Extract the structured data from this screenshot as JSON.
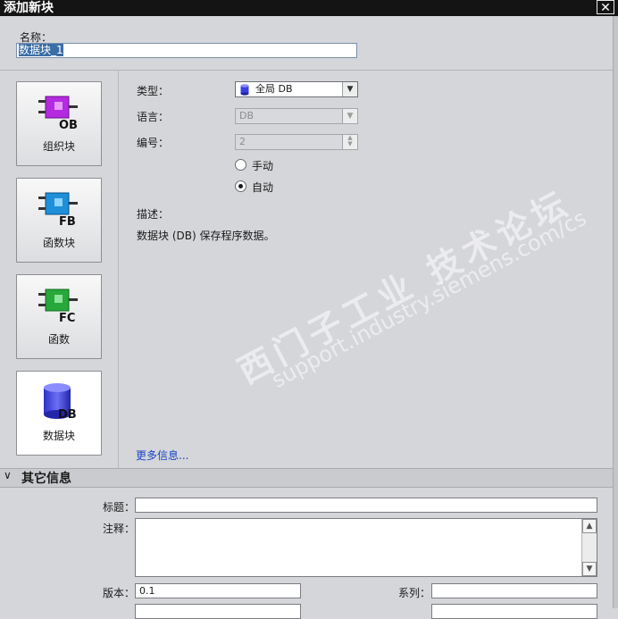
{
  "window": {
    "title": "添加新块",
    "close_glyph": "✕"
  },
  "name": {
    "label": "名称：",
    "value": "数据块_1"
  },
  "block_types": [
    {
      "label": "组织块",
      "tag": "OB",
      "icon": "ob-block-icon",
      "color": "#b42ae0"
    },
    {
      "label": "函数块",
      "tag": "FB",
      "icon": "fb-block-icon",
      "color": "#1e8fd8"
    },
    {
      "label": "函数",
      "tag": "FC",
      "icon": "fc-block-icon",
      "color": "#27a83a"
    },
    {
      "label": "数据块",
      "tag": "DB",
      "icon": "db-block-icon",
      "color": "#3b3fe0"
    }
  ],
  "form": {
    "type_label": "类型：",
    "type_value": "全局 DB",
    "language_label": "语言：",
    "language_value": "DB",
    "number_label": "编号：",
    "number_value": "2",
    "manual_label": "手动",
    "auto_label": "自动",
    "desc_label": "描述：",
    "desc_text": "数据块 (DB) 保存程序数据。",
    "more_info": "更多信息..."
  },
  "watermark": {
    "line1": "西门子工业 技术论坛",
    "line2": "support.industry.siemens.com/cs"
  },
  "other_info": {
    "title": "其它信息",
    "caption_label": "标题：",
    "caption_value": "",
    "comment_label": "注释：",
    "version_label": "版本：",
    "version_value": "0.1",
    "family_label": "系列：",
    "family_value": ""
  },
  "colors": {
    "link": "#1a44c8",
    "title_bar": "#141414",
    "selection": "#3a6ea5"
  }
}
